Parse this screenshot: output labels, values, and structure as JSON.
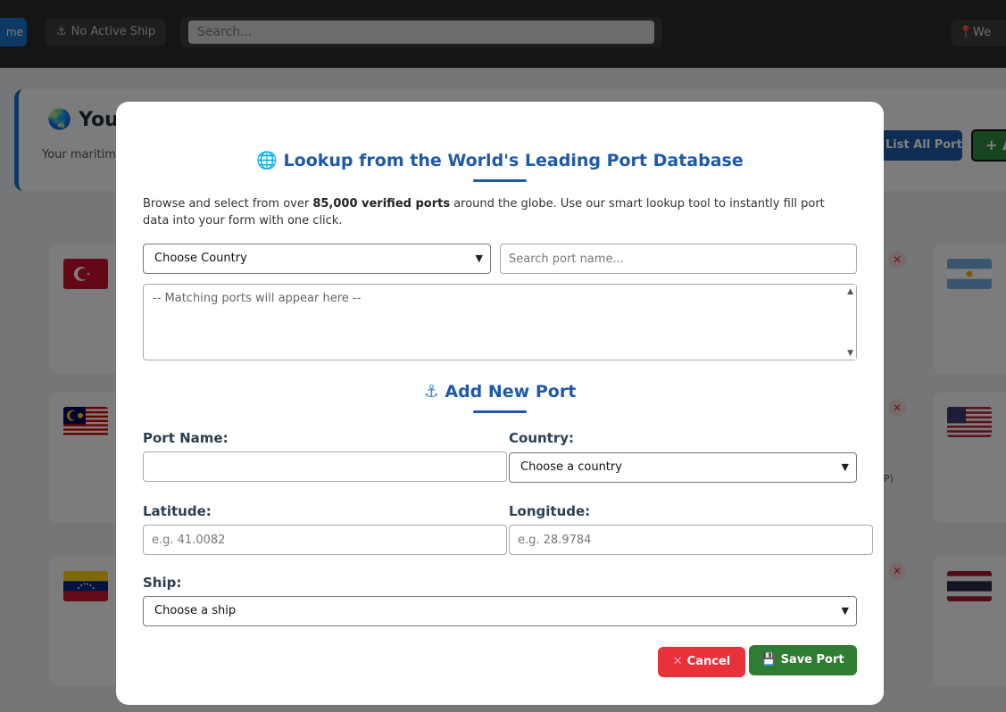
{
  "topbar": {
    "home_label": "me",
    "ship_status": "No Active Ship",
    "search_placeholder": "Search...",
    "user_label": "We"
  },
  "welcome": {
    "title": "You",
    "subtitle": "Your maritime"
  },
  "actions": {
    "list_ports": "List All Ports",
    "add_port": "+ A"
  },
  "cards": {
    "partial_text": "P)"
  },
  "modal": {
    "lookup_title": "Lookup from the World's Leading Port Database",
    "lookup_desc_pre": "Browse and select from over ",
    "lookup_desc_bold": "85,000 verified ports",
    "lookup_desc_post": " around the globe. Use our smart lookup tool to instantly fill port data into your form with one click.",
    "country_filter": "Choose Country",
    "port_search_placeholder": "Search port name...",
    "results_placeholder": "-- Matching ports will appear here --",
    "add_title": "Add New Port",
    "port_name_label": "Port Name:",
    "port_name_value": "",
    "country_label": "Country:",
    "country_value": "Choose a country",
    "latitude_label": "Latitude:",
    "latitude_placeholder": "e.g. 41.0082",
    "longitude_label": "Longitude:",
    "longitude_placeholder": "e.g. 28.9784",
    "ship_label": "Ship:",
    "ship_value": "Choose a ship",
    "cancel_label": "Cancel",
    "save_label": "Save Port"
  },
  "colors": {
    "accent": "#1e5aa8",
    "cancel": "#e8313b",
    "save": "#2e7d32"
  }
}
